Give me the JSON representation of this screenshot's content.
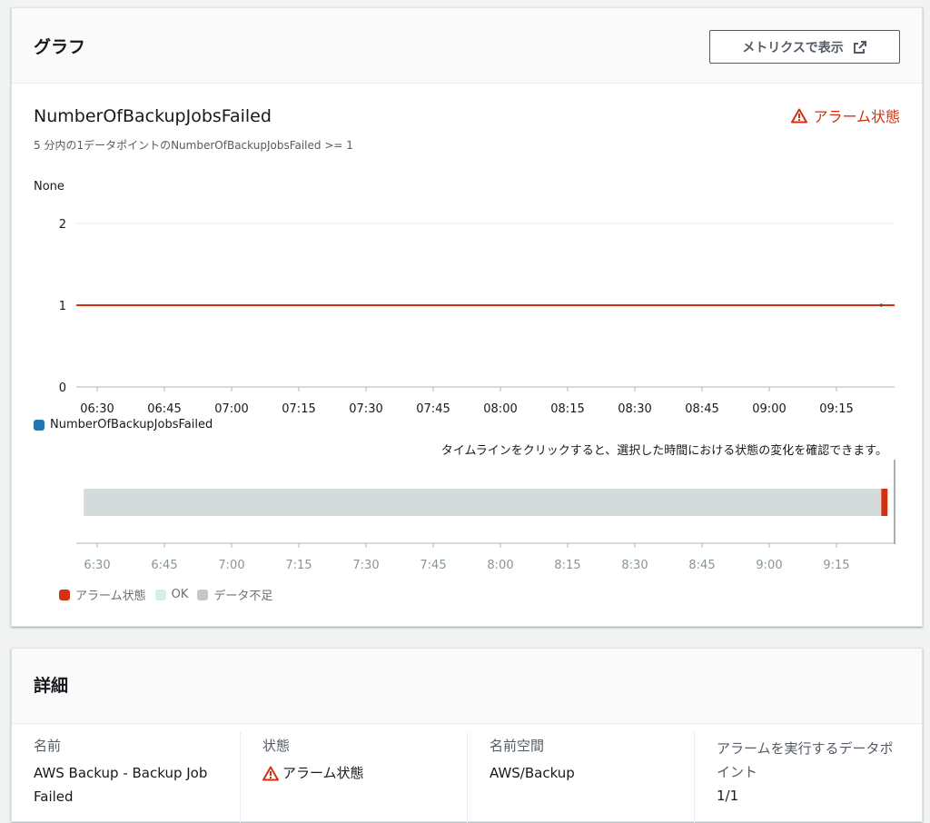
{
  "graph": {
    "title": "グラフ",
    "view_metrics_button": "メトリクスで表示",
    "metric_title": "NumberOfBackupJobsFailed",
    "metric_subtitle": "5 分内の1データポイントのNumberOfBackupJobsFailed >= 1",
    "alarm_state": "アラーム状態",
    "unit_label": "None",
    "legend_series": "NumberOfBackupJobsFailed",
    "timeline_hint": "タイムラインをクリックすると、選択した時間における状態の変化を確認できます。",
    "state_legend": [
      {
        "label": "アラーム状態",
        "color": "#d13212"
      },
      {
        "label": "OK",
        "color": "#d5f0e3"
      },
      {
        "label": "データ不足",
        "color": "#c6c6cd"
      }
    ]
  },
  "chart_data": {
    "type": "line",
    "x": [
      "06:30",
      "06:45",
      "07:00",
      "07:15",
      "07:30",
      "07:45",
      "08:00",
      "08:15",
      "08:30",
      "08:45",
      "09:00",
      "09:15"
    ],
    "y_ticks": [
      0,
      1,
      2
    ],
    "ylim": [
      0,
      2
    ],
    "ylabel": "None",
    "threshold": 1,
    "threshold_color": "#d13212",
    "series": [
      {
        "name": "NumberOfBackupJobsFailed",
        "color": "#1f77b4",
        "points": [
          {
            "x": "09:25",
            "y": 1
          }
        ]
      }
    ],
    "timeline": {
      "ticks": [
        "6:30",
        "6:45",
        "7:00",
        "7:15",
        "7:30",
        "7:45",
        "8:00",
        "8:15",
        "8:30",
        "8:45",
        "9:00",
        "9:15"
      ],
      "segments": [
        {
          "state": "データ不足",
          "color": "#d5dbdb",
          "from": "06:27",
          "to": "09:25"
        },
        {
          "state": "アラーム状態",
          "color": "#d13212",
          "from": "09:25",
          "to": "09:26"
        }
      ]
    }
  },
  "details": {
    "title": "詳細",
    "columns": [
      {
        "label": "名前",
        "value": "AWS Backup - Backup Job Failed"
      },
      {
        "label": "状態",
        "value": "アラーム状態"
      },
      {
        "label": "名前空間",
        "value": "AWS/Backup"
      },
      {
        "label": "アラームを実行するデータポイント",
        "value": "1/1"
      }
    ]
  },
  "colors": {
    "alarm": "#d13212",
    "text": "#16191f",
    "muted": "#545b64"
  },
  "icons": [
    "external-link-icon",
    "warning-icon"
  ]
}
